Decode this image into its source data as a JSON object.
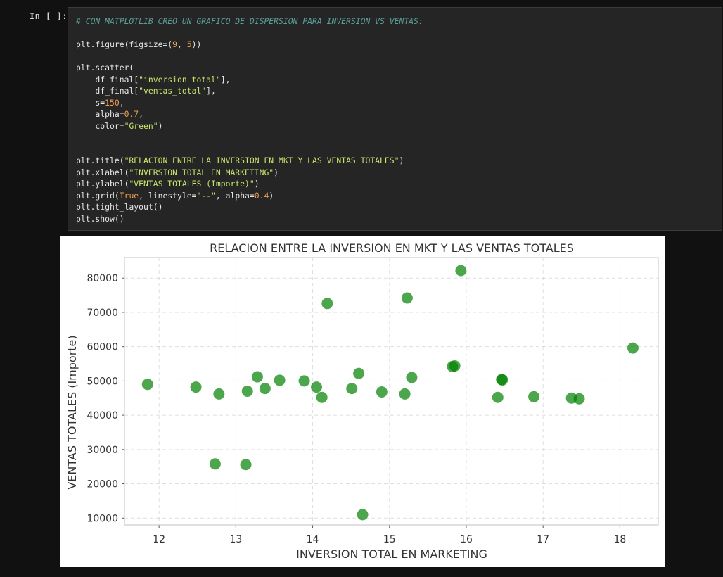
{
  "notebook": {
    "prompt": "In [ ]:",
    "code_lines": [
      [
        {
          "t": "cmt",
          "v": "# CON MATPLOTLIB CREO UN GRAFICO DE DISPERSION PARA INVERSION VS VENTAS:"
        }
      ],
      [],
      [
        {
          "t": "fn",
          "v": "plt.figure(figsize=("
        },
        {
          "t": "num",
          "v": "9"
        },
        {
          "t": "fn",
          "v": ", "
        },
        {
          "t": "num",
          "v": "5"
        },
        {
          "t": "fn",
          "v": "))"
        }
      ],
      [],
      [
        {
          "t": "fn",
          "v": "plt.scatter("
        }
      ],
      [
        {
          "t": "fn",
          "v": "    df_final["
        },
        {
          "t": "str",
          "v": "\"inversion_total\""
        },
        {
          "t": "fn",
          "v": "],"
        }
      ],
      [
        {
          "t": "fn",
          "v": "    df_final["
        },
        {
          "t": "str",
          "v": "\"ventas_total\""
        },
        {
          "t": "fn",
          "v": "],"
        }
      ],
      [
        {
          "t": "fn",
          "v": "    s="
        },
        {
          "t": "num",
          "v": "150"
        },
        {
          "t": "fn",
          "v": ","
        }
      ],
      [
        {
          "t": "fn",
          "v": "    alpha="
        },
        {
          "t": "num",
          "v": "0.7"
        },
        {
          "t": "fn",
          "v": ","
        }
      ],
      [
        {
          "t": "fn",
          "v": "    color="
        },
        {
          "t": "str",
          "v": "\"Green\""
        },
        {
          "t": "fn",
          "v": ")"
        }
      ],
      [],
      [],
      [
        {
          "t": "fn",
          "v": "plt.title("
        },
        {
          "t": "str",
          "v": "\"RELACION ENTRE LA INVERSION EN MKT Y LAS VENTAS TOTALES\""
        },
        {
          "t": "fn",
          "v": ")"
        }
      ],
      [
        {
          "t": "fn",
          "v": "plt.xlabel("
        },
        {
          "t": "str",
          "v": "\"INVERSION TOTAL EN MARKETING\""
        },
        {
          "t": "fn",
          "v": ")"
        }
      ],
      [
        {
          "t": "fn",
          "v": "plt.ylabel("
        },
        {
          "t": "str",
          "v": "\"VENTAS TOTALES (Importe)\""
        },
        {
          "t": "fn",
          "v": ")"
        }
      ],
      [
        {
          "t": "fn",
          "v": "plt.grid("
        },
        {
          "t": "kw",
          "v": "True"
        },
        {
          "t": "fn",
          "v": ", linestyle="
        },
        {
          "t": "str",
          "v": "\"--\""
        },
        {
          "t": "fn",
          "v": ", alpha="
        },
        {
          "t": "num",
          "v": "0.4"
        },
        {
          "t": "fn",
          "v": ")"
        }
      ],
      [
        {
          "t": "fn",
          "v": "plt.tight_layout()"
        }
      ],
      [
        {
          "t": "fn",
          "v": "plt.show()"
        }
      ]
    ]
  },
  "chart_data": {
    "type": "scatter",
    "title": "RELACION ENTRE LA INVERSION EN MKT Y LAS VENTAS TOTALES",
    "xlabel": "INVERSION TOTAL EN MARKETING",
    "ylabel": "VENTAS TOTALES (Importe)",
    "xlim": [
      11.55,
      18.5
    ],
    "ylim": [
      8000,
      86000
    ],
    "xticks": [
      12,
      13,
      14,
      15,
      16,
      17,
      18
    ],
    "yticks": [
      10000,
      20000,
      30000,
      40000,
      50000,
      60000,
      70000,
      80000
    ],
    "grid": true,
    "color": "#008000",
    "alpha": 0.7,
    "points": [
      [
        11.85,
        49000
      ],
      [
        12.48,
        48200
      ],
      [
        12.73,
        25800
      ],
      [
        12.78,
        46200
      ],
      [
        13.13,
        25600
      ],
      [
        13.15,
        47000
      ],
      [
        13.28,
        51200
      ],
      [
        13.38,
        47800
      ],
      [
        13.57,
        50200
      ],
      [
        13.89,
        50000
      ],
      [
        14.05,
        48200
      ],
      [
        14.12,
        45200
      ],
      [
        14.19,
        72600
      ],
      [
        14.51,
        47800
      ],
      [
        14.6,
        52200
      ],
      [
        14.65,
        11000
      ],
      [
        14.9,
        46800
      ],
      [
        15.2,
        46200
      ],
      [
        15.23,
        74200
      ],
      [
        15.29,
        51000
      ],
      [
        15.82,
        54200
      ],
      [
        15.85,
        54400
      ],
      [
        15.93,
        82200
      ],
      [
        16.41,
        45200
      ],
      [
        16.46,
        50400
      ],
      [
        16.47,
        50300
      ],
      [
        16.88,
        45400
      ],
      [
        17.37,
        45000
      ],
      [
        17.47,
        44800
      ],
      [
        18.17,
        59600
      ]
    ]
  }
}
